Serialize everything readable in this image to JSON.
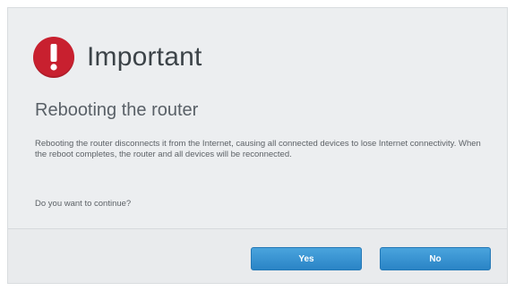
{
  "dialog": {
    "icon": "exclamation-icon",
    "title": "Important",
    "subtitle": "Rebooting the router",
    "message": "Rebooting the router disconnects it from the Internet, causing all connected devices to lose Internet connectivity. When the reboot completes, the router and all devices will be reconnected.",
    "question": "Do you want to continue?",
    "yes_label": "Yes",
    "no_label": "No"
  },
  "colors": {
    "alert": "#c8202f",
    "button": "#3a94d2",
    "background": "#eceef0"
  }
}
